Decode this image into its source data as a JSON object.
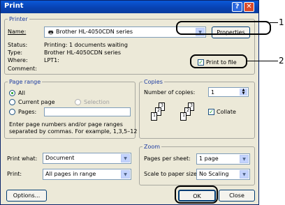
{
  "window": {
    "title": "Print",
    "help_glyph": "?",
    "close_glyph": "✕"
  },
  "printer": {
    "legend": "Printer",
    "name_label": "Name:",
    "name_value": "Brother HL-4050CDN series",
    "properties_label": "Properties",
    "status_label": "Status:",
    "status_value": "Printing: 1 documents waiting",
    "type_label": "Type:",
    "type_value": "Brother HL-4050CDN series",
    "where_label": "Where:",
    "where_value": "LPT1:",
    "comment_label": "Comment:",
    "print_to_file_label": "Print to file",
    "print_to_file_checked": true
  },
  "page_range": {
    "legend": "Page range",
    "all_label": "All",
    "current_page_label": "Current page",
    "selection_label": "Selection",
    "pages_label": "Pages:",
    "pages_value": "",
    "selected": "all",
    "help_line1": "Enter page numbers and/or page ranges",
    "help_line2": "separated by commas.  For example, 1,3,5–12"
  },
  "copies": {
    "legend": "Copies",
    "number_label": "Number of copies:",
    "number_value": "1",
    "collate_label": "Collate",
    "collate_checked": true
  },
  "zoom": {
    "legend": "Zoom",
    "pages_per_sheet_label": "Pages per sheet:",
    "pages_per_sheet_value": "1 page",
    "scale_label": "Scale to paper size:",
    "scale_value": "No Scaling"
  },
  "print_what": {
    "label": "Print what:",
    "value": "Document"
  },
  "print": {
    "label": "Print:",
    "value": "All pages in range"
  },
  "buttons": {
    "options": "Options...",
    "ok": "OK",
    "close": "Close"
  },
  "callouts": {
    "one": "1",
    "two": "2"
  },
  "collate_icons": {
    "page1": "1",
    "page2": "2",
    "page3": "3"
  }
}
